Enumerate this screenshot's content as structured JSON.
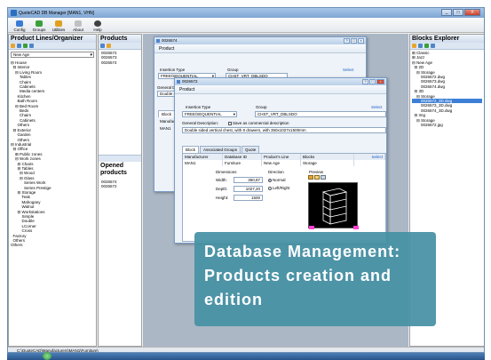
{
  "window": {
    "title": "QuoteCAD DB Manager [MAN1, VHN]",
    "controls": [
      "_",
      "□",
      "X"
    ]
  },
  "toolbar": [
    {
      "label": "Config",
      "color": "#3a7bd5"
    },
    {
      "label": "Groups",
      "color": "#3aa03a"
    },
    {
      "label": "Utilities",
      "color": "#e0a020"
    },
    {
      "label": "About",
      "color": "#c0c0c0"
    },
    {
      "label": "Help",
      "color": "#404040"
    }
  ],
  "left_panel": {
    "title": "Product Lines/Organizer",
    "selected": "New Age",
    "tree": [
      "⊟ House",
      "  ⊟ Interior",
      "    ⊟ Living Room",
      "        Tables",
      "        Chairs",
      "        Cabinets",
      "        Media centers",
      "      Kitchen",
      "      Bath Room",
      "    ⊟ Bed Room",
      "        Beds",
      "        Chairs",
      "        Cabinets",
      "      Others",
      "  ⊟ Exterior",
      "      Garden",
      "      Others",
      "⊟ Industrial",
      "  ⊟ Office",
      "    ⊞ Public zones",
      "    ⊟ Work zones",
      "      ⊟ Chairs",
      "      ⊟ Tables",
      "        ⊟ Wood",
      "        ⊟ Glass",
      "            Series Work",
      "            Series Prestige",
      "      ⊟ Storage",
      "          Teak",
      "          Mahogany",
      "          Walnut",
      "      ⊟ Workstations",
      "          Simple",
      "          Double",
      "          LCorner",
      "          Cross",
      "  Factory",
      "  Others",
      "Others"
    ]
  },
  "products_panel": {
    "title": "Products",
    "items": [
      "0026572",
      "0026573",
      "0026574"
    ],
    "opened_title": "Opened products",
    "opened_items": [
      "0026574",
      "0026572"
    ]
  },
  "blocks_panel": {
    "title": "Blocks Explorer",
    "tree": [
      "⊞ Classic",
      "⊞ Jazz",
      "⊟ New Age",
      "  ⊟ 2D",
      "    ⊟ Storage",
      "        0026572.dwg",
      "        0026573.dwg",
      "        0026574.dwg",
      "  ⊟ 3D",
      "    ⊟ Storage",
      "        0026572_3D.dwg",
      "        0026573_3D.dwg",
      "        0026574_3D.dwg",
      "  ⊟ Img",
      "    ⊟ Storage",
      "        0026572.jpg"
    ],
    "highlighted": "0026572_3D.dwg"
  },
  "dialog_back": {
    "title": "0026574",
    "subtitle": "Product",
    "insertion_label": "Insertion Type",
    "insertion_value": "FREE/SEQUENTIAL",
    "group_label": "Group",
    "group_value": "CHST_VRT_DBLSDO",
    "select": "Select",
    "general_label": "General Descr",
    "general_value": "Double sided",
    "tab_block": "Block",
    "tab_assoc": "Asso",
    "manufacturer": "Manufactur",
    "manufacturer_value": "MAN1"
  },
  "dialog": {
    "title": "0026572",
    "subtitle": "Product",
    "insertion_label": "Insertion Type",
    "insertion_value": "FREE/SEQUENTIAL",
    "group_label": "Group",
    "group_value": "CHST_VRT_DBLSDO",
    "select": "Select",
    "general_label": "General Description:",
    "save_label": "Save as commercial description",
    "description": "Double sided vertical chest, with 8 drawers, with 350x1027x1500mm",
    "tabs": [
      "Block",
      "Associated Groups",
      "Quote"
    ],
    "grid_headers": [
      "Manufacturer",
      "Database ID",
      "Product's Line",
      "Blocks"
    ],
    "grid_select": "Select",
    "grid_row": [
      "MAN1",
      "Furniture",
      "New Age",
      "Storage"
    ],
    "dimensions_label": "Dimensions",
    "width_label": "Width:",
    "width_value": "350,87",
    "depth_label": "Depth:",
    "depth_value": "1027,20",
    "height_label": "Height:",
    "height_value": "1500",
    "direction_label": "Direction",
    "dir_normal": "Normal",
    "dir_leftright": "Left/Right",
    "preview_label": "Preview"
  },
  "status_bar": {
    "path": "C:\\QuoteCAD\\Manufacturers\\MAN1\\Furniture\\"
  },
  "banner": {
    "lines": [
      "Database Management:",
      "Products creation and",
      "edition"
    ]
  }
}
